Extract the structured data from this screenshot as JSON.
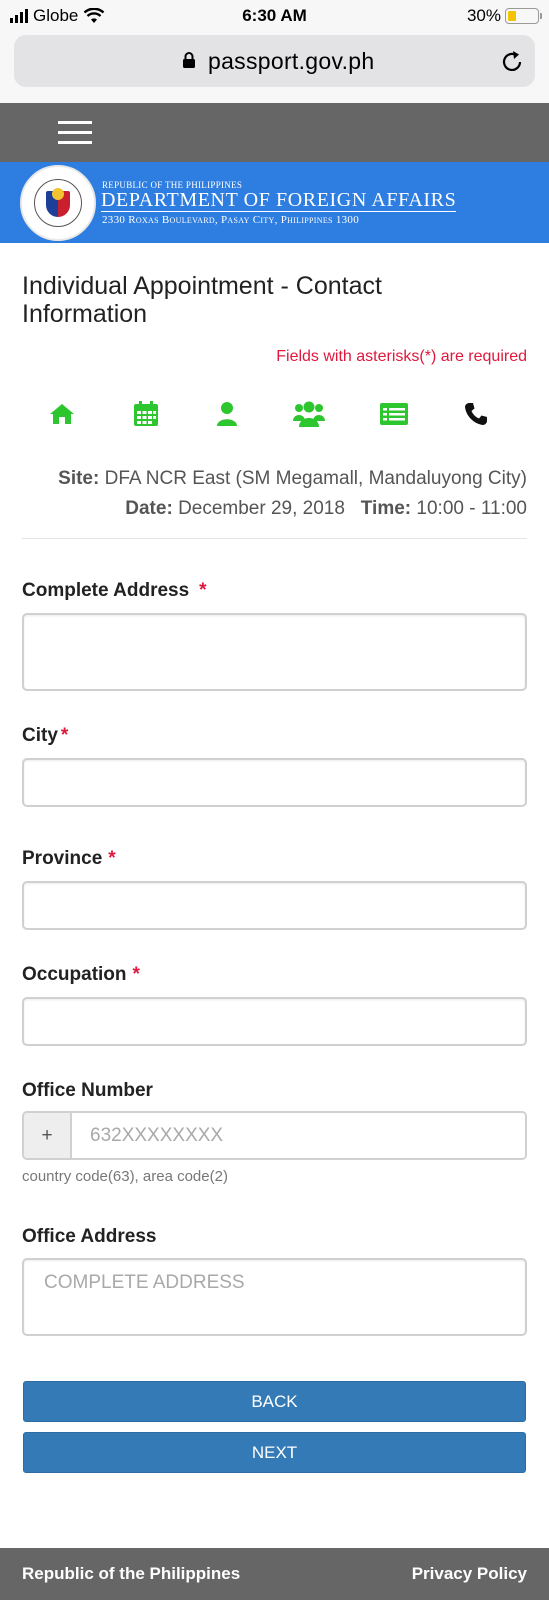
{
  "status_bar": {
    "carrier": "Globe",
    "time": "6:30 AM",
    "battery": "30%",
    "battery_level": 0.3
  },
  "browser": {
    "url": "passport.gov.ph"
  },
  "banner": {
    "top_line": "REPUBLIC OF THE PHILIPPINES",
    "main_title": "DEPARTMENT OF FOREIGN AFFAIRS",
    "address": "2330 Roxas Boulevard, Pasay City, Philippines 1300"
  },
  "page": {
    "title": "Individual Appointment - Contact Information",
    "required_note": "Fields with asterisks(*) are required"
  },
  "steps": [
    {
      "icon": "home-icon",
      "color": "#2ec62e"
    },
    {
      "icon": "calendar-icon",
      "color": "#2ec62e"
    },
    {
      "icon": "user-icon",
      "color": "#2ec62e"
    },
    {
      "icon": "users-icon",
      "color": "#2ec62e"
    },
    {
      "icon": "list-card-icon",
      "color": "#2ec62e"
    },
    {
      "icon": "phone-icon",
      "color": "#111111"
    }
  ],
  "appointment": {
    "site_label": "Site:",
    "site_value": "DFA NCR East (SM Megamall, Mandaluyong City)",
    "date_label": "Date:",
    "date_value": "December 29, 2018",
    "time_label": "Time:",
    "time_value": "10:00 - 11:00"
  },
  "form": {
    "complete_address": {
      "label": "Complete Address",
      "required": "*",
      "value": ""
    },
    "city": {
      "label": "City",
      "required": "*",
      "value": ""
    },
    "province": {
      "label": "Province",
      "required": "*",
      "value": ""
    },
    "occupation": {
      "label": "Occupation",
      "required": "*",
      "value": ""
    },
    "office_number": {
      "label": "Office Number",
      "prefix": "+",
      "placeholder": "632XXXXXXXX",
      "help": "country code(63), area code(2)"
    },
    "office_address": {
      "label": "Office Address",
      "placeholder": "COMPLETE ADDRESS"
    }
  },
  "buttons": {
    "back": "BACK",
    "next": "NEXT"
  },
  "footer": {
    "left": "Republic of the Philippines",
    "right": "Privacy Policy"
  },
  "colors": {
    "banner_blue": "#2e7de0",
    "button_blue": "#337ab7",
    "required_red": "#e0183c",
    "nav_gray": "#666666"
  }
}
